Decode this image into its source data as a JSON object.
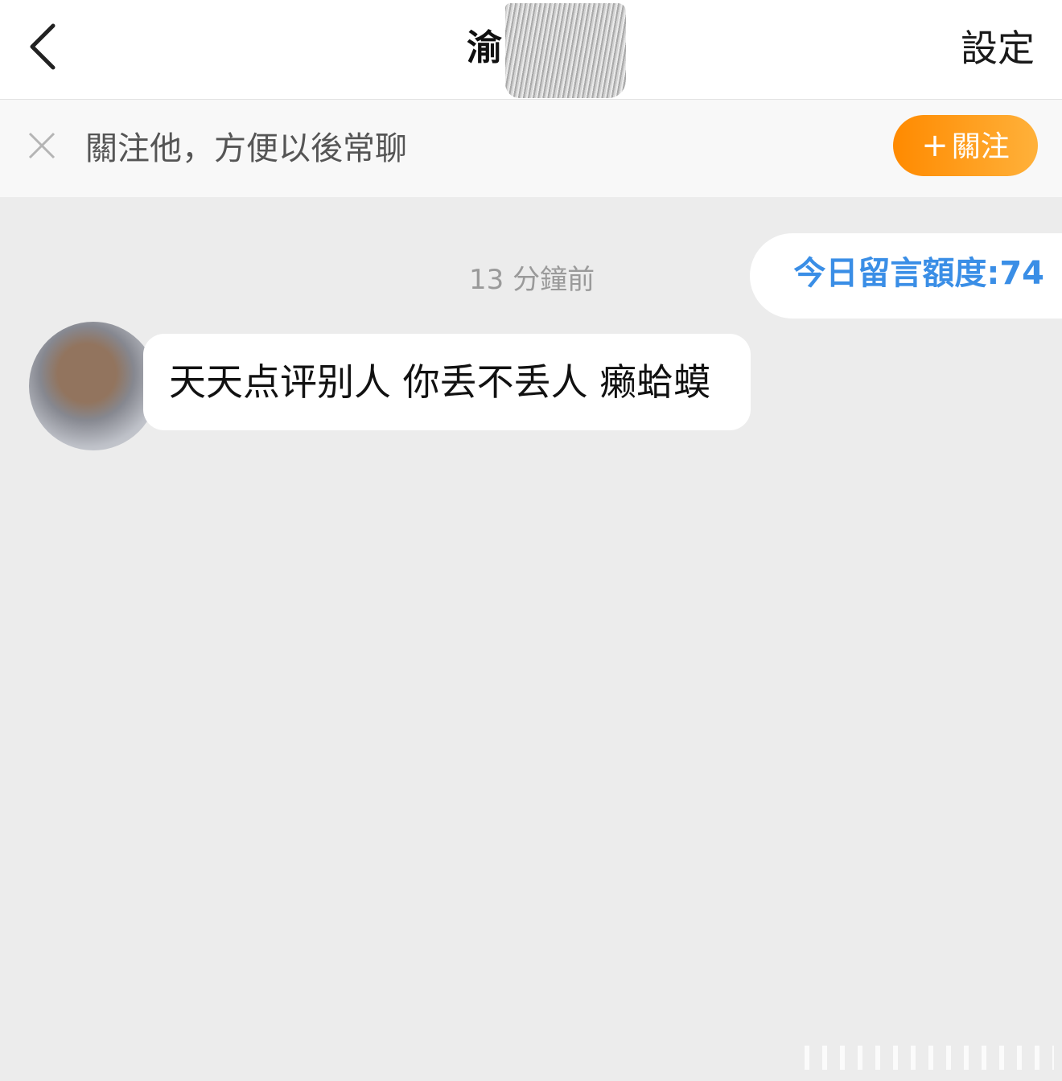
{
  "header": {
    "title": "渝",
    "settings_label": "設定"
  },
  "follow_banner": {
    "text": "關注他，方便以後常聊",
    "button_plus": "+",
    "button_label": "關注"
  },
  "chat": {
    "quota_label": "今日留言額度:74",
    "timestamp": "13 分鐘前",
    "messages": [
      {
        "sender": "other",
        "text": "天天点评别人 你丢不丢人 癞蛤蟆"
      }
    ]
  },
  "colors": {
    "accent_orange": "#ff9a1f",
    "quota_blue": "#3a8ee6",
    "background": "#ececec"
  }
}
